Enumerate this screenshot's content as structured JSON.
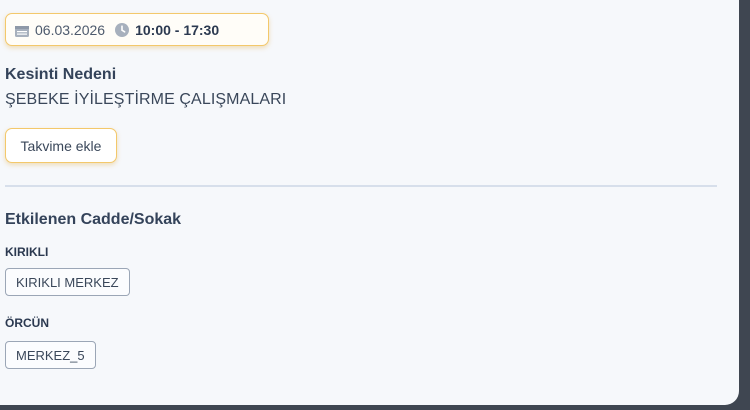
{
  "schedule": {
    "date": "06.03.2026",
    "time": "10:00 - 17:30"
  },
  "reason": {
    "title": "Kesinti Nedeni",
    "value": "ŞEBEKE İYİLEŞTİRME ÇALIŞMALARI"
  },
  "calendar_button": "Takvime ekle",
  "streets": {
    "title": "Etkilenen Cadde/Sokak",
    "groups": [
      {
        "name": "KIRIKLI",
        "items": [
          "KIRIKLI MERKEZ"
        ]
      },
      {
        "name": "ÖRCÜN",
        "items": [
          "MERKEZ_5"
        ]
      }
    ]
  },
  "icons": {
    "date": "calendar-icon",
    "time": "clock-icon"
  },
  "colors": {
    "accent_border": "#f3c86b",
    "card_background": "#f6f8fb",
    "backdrop": "#3f4651"
  }
}
